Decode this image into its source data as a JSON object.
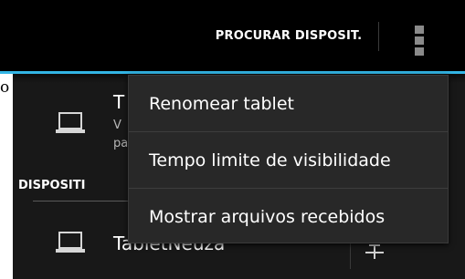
{
  "action_bar": {
    "search_button_label": "PROCURAR DISPOSIT.",
    "overflow_icon": "overflow-menu-icon",
    "underline_color": "#33b5e5"
  },
  "left_edge_text": "o",
  "this_device": {
    "icon": "laptop-icon",
    "name_partial": "T",
    "subtitle_line1_partial": "V",
    "subtitle_line2_partial": "pa"
  },
  "section": {
    "header_partial": "DISPOSITI"
  },
  "paired_device": {
    "icon": "laptop-icon",
    "name": "TabletNeuza",
    "settings_icon": "settings-sliders-icon"
  },
  "overflow_menu": {
    "items": [
      {
        "label": "Renomear tablet"
      },
      {
        "label": "Tempo limite de visibilidade"
      },
      {
        "label": "Mostrar arquivos recebidos"
      }
    ]
  }
}
